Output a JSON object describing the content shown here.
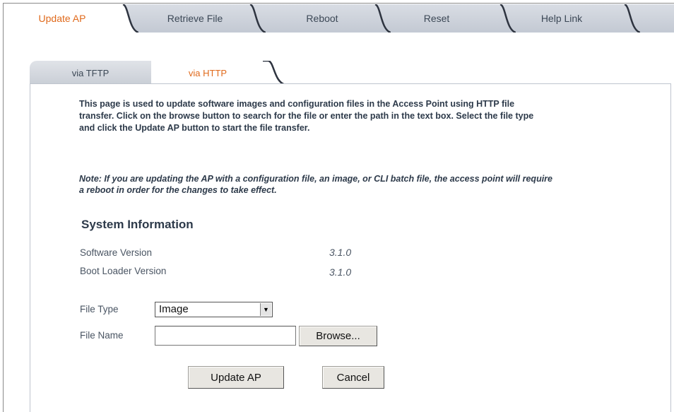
{
  "top_tabs": [
    {
      "label": "Update AP",
      "active": true
    },
    {
      "label": "Retrieve File",
      "active": false
    },
    {
      "label": "Reboot",
      "active": false
    },
    {
      "label": "Reset",
      "active": false
    },
    {
      "label": "Help Link",
      "active": false
    }
  ],
  "sub_tabs": [
    {
      "label": "via TFTP",
      "active": false
    },
    {
      "label": "via HTTP",
      "active": true
    }
  ],
  "intro_text": "This page is used to update software images and configuration files in the Access Point using HTTP file transfer. Click on the browse button to search for the file or enter the path in the text box. Select the file type and click the Update AP button to start the file transfer.",
  "note_text": "Note: If you are updating the AP with a configuration file, an image, or CLI batch file, the access point will require a reboot in order for the changes to take effect.",
  "system_info": {
    "title": "System Information",
    "software_version_label": "Software Version",
    "software_version_value": "3.1.0",
    "boot_loader_label": "Boot Loader Version",
    "boot_loader_value": "3.1.0"
  },
  "form": {
    "file_type_label": "File Type",
    "file_type_value": "Image",
    "file_name_label": "File Name",
    "file_name_value": "",
    "browse_label": "Browse...",
    "update_label": "Update AP",
    "cancel_label": "Cancel"
  },
  "colors": {
    "active_tab_text": "#e06a1c",
    "text": "#2d3a4a",
    "tab_bar": "#c9ced6"
  }
}
